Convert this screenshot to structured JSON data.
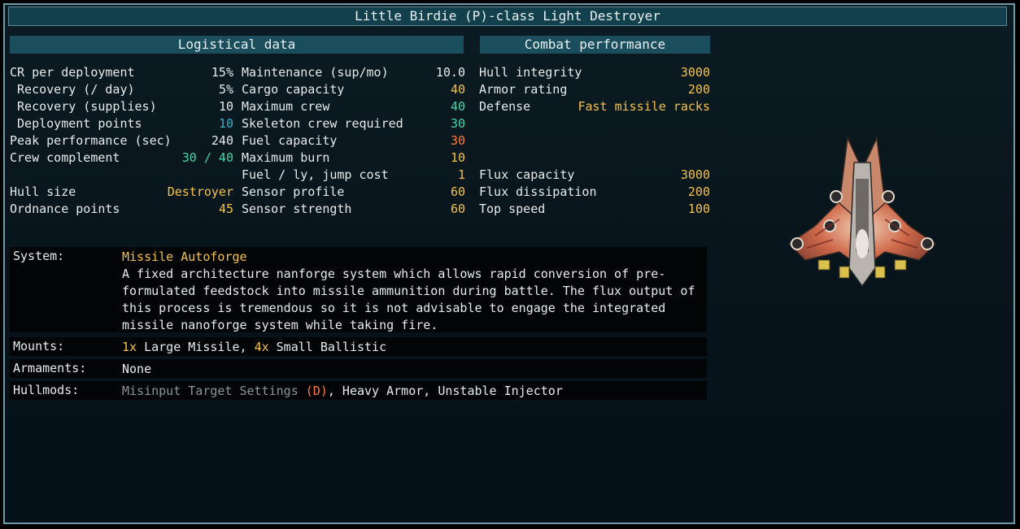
{
  "title": "Little Birdie (P)-class Light Destroyer",
  "logistical": {
    "header": "Logistical data",
    "col1": [
      {
        "label": "CR per deployment",
        "value": "15%",
        "color": "#e6ebee"
      },
      {
        "label": " Recovery (/ day)",
        "value": "5%",
        "color": "#e6ebee"
      },
      {
        "label": " Recovery (supplies)",
        "value": "10",
        "color": "#e6ebee"
      },
      {
        "label": " Deployment points",
        "value": "10",
        "color": "#2fb3c8"
      },
      {
        "label": "Peak performance (sec)",
        "value": "240",
        "color": "#e6ebee"
      },
      {
        "label": "Crew complement",
        "value": "30 / 40",
        "color": "#43d6a4"
      },
      {
        "label": "Hull size",
        "value": "Destroyer",
        "color": "#f4c24a"
      },
      {
        "label": "Ordnance points",
        "value": "45",
        "color": "#f4c24a"
      }
    ],
    "col2": [
      {
        "label": "Maintenance (sup/mo)",
        "value": "10.0",
        "color": "#e6ebee"
      },
      {
        "label": "Cargo capacity",
        "value": "40",
        "color": "#f4c24a"
      },
      {
        "label": "Maximum crew",
        "value": "40",
        "color": "#43d6a4"
      },
      {
        "label": "Skeleton crew required",
        "value": "30",
        "color": "#43d6a4"
      },
      {
        "label": "Fuel capacity",
        "value": "30",
        "color": "#ff7a3c"
      },
      {
        "label": "Maximum burn",
        "value": "10",
        "color": "#f4c24a"
      },
      {
        "label": "Fuel / ly, jump cost",
        "value": "1",
        "color": "#f4c24a"
      },
      {
        "label": "Sensor profile",
        "value": "60",
        "color": "#f4c24a"
      },
      {
        "label": "Sensor strength",
        "value": "60",
        "color": "#f4c24a"
      }
    ]
  },
  "combat": {
    "header": "Combat performance",
    "top": [
      {
        "label": "Hull integrity",
        "value": "3000",
        "color": "#f4c24a"
      },
      {
        "label": "Armor rating",
        "value": "200",
        "color": "#f4c24a"
      },
      {
        "label": "Defense",
        "value": "Fast missile racks",
        "color": "#f4c24a"
      }
    ],
    "bottom": [
      {
        "label": "Flux capacity",
        "value": "3000",
        "color": "#f4c24a"
      },
      {
        "label": "Flux dissipation",
        "value": "200",
        "color": "#f4c24a"
      },
      {
        "label": "Top speed",
        "value": "100",
        "color": "#f4c24a"
      }
    ]
  },
  "details": {
    "system_label": "System:",
    "system_name": "Missile Autoforge",
    "system_desc_lines": [
      "A fixed architecture nanforge system which allows rapid conversion of pre-",
      "formulated feedstock into missile ammunition during battle. The flux output of",
      "this process is tremendous so it is not advisable to engage the integrated",
      "missile nanoforge system while taking fire."
    ],
    "mounts_label": "Mounts:",
    "mounts_count1": "1x",
    "mounts_type1": " Large Missile, ",
    "mounts_count2": "4x",
    "mounts_type2": " Small Ballistic",
    "armaments_label": "Armaments:",
    "armaments_value": "None",
    "hullmods_label": "Hullmods:",
    "hullmods_dmod": "Misinput Target Settings",
    "hullmods_dtag": "(D)",
    "hullmods_rest": ", Heavy Armor, Unstable Injector"
  },
  "ship_icon": "ship-sprite-icon"
}
